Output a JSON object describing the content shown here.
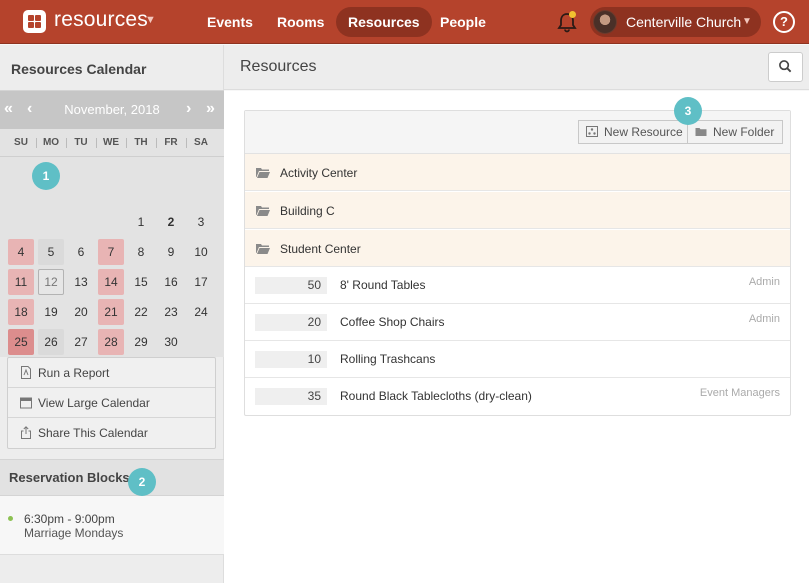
{
  "topbar": {
    "brand": "resources",
    "nav": [
      {
        "label": "Events",
        "active": false
      },
      {
        "label": "Rooms",
        "active": false
      },
      {
        "label": "Resources",
        "active": true
      },
      {
        "label": "People",
        "active": false
      }
    ],
    "account_name": "Centerville Church",
    "help": "?"
  },
  "sidebar": {
    "title": "Resources Calendar",
    "calendar": {
      "prev_year": "«",
      "prev_month": "‹",
      "month": "November, 2018",
      "next_month": "›",
      "next_year": "»",
      "weekdays": [
        "SU",
        "MO",
        "TU",
        "WE",
        "TH",
        "FR",
        "SA"
      ],
      "days": [
        "1",
        "2",
        "3",
        "4",
        "5",
        "6",
        "7",
        "8",
        "9",
        "10",
        "11",
        "12",
        "13",
        "14",
        "15",
        "16",
        "17",
        "18",
        "19",
        "20",
        "21",
        "22",
        "23",
        "24",
        "25",
        "26",
        "27",
        "28",
        "29",
        "30"
      ]
    },
    "actions": [
      {
        "label": "Run a Report",
        "icon": "report-icon"
      },
      {
        "label": "View Large Calendar",
        "icon": "calendar-icon"
      },
      {
        "label": "Share This Calendar",
        "icon": "share-icon"
      }
    ],
    "reservation_blocks": {
      "title": "Reservation Blocks",
      "items": [
        {
          "time": "6:30pm - 9:00pm",
          "name": "Marriage Mondays",
          "color": "#8cc152"
        }
      ]
    }
  },
  "main": {
    "title": "Resources",
    "toolbar": {
      "new_resource": "New Resource",
      "new_folder": "New Folder"
    },
    "folders": [
      "Activity Center",
      "Building C",
      "Student Center"
    ],
    "resources": [
      {
        "qty": "50",
        "name": "8' Round Tables",
        "owner": "Admin"
      },
      {
        "qty": "20",
        "name": "Coffee Shop Chairs",
        "owner": "Admin"
      },
      {
        "qty": "10",
        "name": "Rolling Trashcans",
        "owner": ""
      },
      {
        "qty": "35",
        "name": "Round Black Tablecloths (dry-clean)",
        "owner": "Event Managers"
      }
    ]
  },
  "steps": [
    "1",
    "2",
    "3"
  ],
  "colors": {
    "brand": "#b5432c",
    "step": "#5fbfc6"
  }
}
